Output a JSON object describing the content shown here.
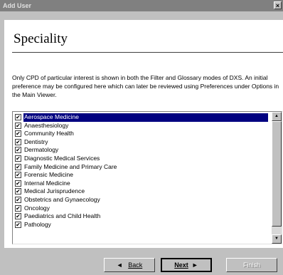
{
  "window": {
    "title": "Add User",
    "close_label": "×"
  },
  "page": {
    "heading": "Speciality",
    "description": "Only CPD of particular interest is shown in both the Filter and Glossary modes of DXS.  An initial preference may be configured here which can later be reviewed using Preferences under Options in the Main Viewer."
  },
  "specialities": [
    {
      "label": "Aerospace Medicine",
      "checked": true,
      "selected": true
    },
    {
      "label": "Anaesthesiology",
      "checked": true
    },
    {
      "label": "Community Health",
      "checked": true
    },
    {
      "label": "Dentistry",
      "checked": true
    },
    {
      "label": "Dermatology",
      "checked": true
    },
    {
      "label": "Diagnostic Medical Services",
      "checked": true
    },
    {
      "label": "Family Medicine and Primary Care",
      "checked": true
    },
    {
      "label": "Forensic Medicine",
      "checked": true
    },
    {
      "label": "Internal Medicine",
      "checked": true
    },
    {
      "label": "Medical Jurisprudence",
      "checked": true
    },
    {
      "label": "Obstetrics and Gynaecology",
      "checked": true
    },
    {
      "label": "Oncology",
      "checked": true
    },
    {
      "label": "Paediatrics and Child Health",
      "checked": true
    },
    {
      "label": "Pathology",
      "checked": true
    }
  ],
  "checkmark": "✔",
  "scroll_up_glyph": "▲",
  "scroll_down_glyph": "▼",
  "buttons": {
    "back": {
      "arrow": "◄",
      "label": "Back"
    },
    "next": {
      "label": "Next",
      "arrow": "►"
    },
    "finish": {
      "label": "Finish"
    }
  }
}
